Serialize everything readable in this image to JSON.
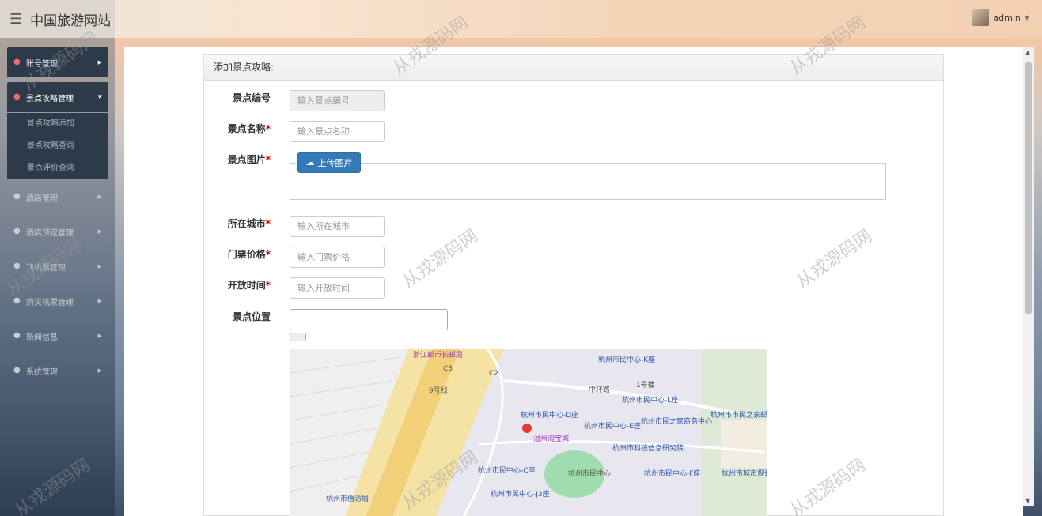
{
  "app": {
    "title": "中国旅游网站",
    "user": "admin"
  },
  "sidebar": {
    "items": [
      {
        "label": "账号管理"
      },
      {
        "label": "景点攻略管理"
      },
      {
        "label": "酒店管理"
      },
      {
        "label": "酒店预定管理"
      },
      {
        "label": "飞机票管理"
      },
      {
        "label": "购买机票管理"
      },
      {
        "label": "新闻信息"
      },
      {
        "label": "系统管理"
      }
    ],
    "submenu": [
      "景点攻略添加",
      "景点攻略查询",
      "景点评价查询"
    ]
  },
  "panel": {
    "title": "添加景点攻略:"
  },
  "form": {
    "code": {
      "label": "景点编号",
      "placeholder": "输入景点编号"
    },
    "name": {
      "label": "景点名称",
      "placeholder": "输入景点名称"
    },
    "image": {
      "label": "景点图片",
      "button": "上传图片"
    },
    "city": {
      "label": "所在城市",
      "placeholder": "输入所在城市"
    },
    "price": {
      "label": "门票价格",
      "placeholder": "输入门票价格"
    },
    "hours": {
      "label": "开放时间",
      "placeholder": "输入开放时间"
    },
    "location": {
      "label": "景点位置"
    },
    "required_mark": "*"
  },
  "map": {
    "labels": [
      "浙江邮币长邮局",
      "杭州市民中心-K座",
      "1号楼",
      "中环路",
      "杭州市民中心-L座",
      "杭州市民中心-D座",
      "杭州市民中心-E座",
      "杭州市民之家商务中心",
      "杭州市市民之家邮政所",
      "温州淘宝城",
      "杭州市科技信息研究院",
      "杭州市民中心-C座",
      "杭州市民中心",
      "杭州市民中心-F座",
      "杭州市城市规划展览馆",
      "杭州市民中心-J3座",
      "杭州市信访局",
      "9号线",
      "C3",
      "C2"
    ]
  },
  "watermark": "从戎源码网",
  "colors": {
    "primary": "#337ab7",
    "sidebar_active": "#2d3a4a",
    "required": "#cc0000"
  }
}
